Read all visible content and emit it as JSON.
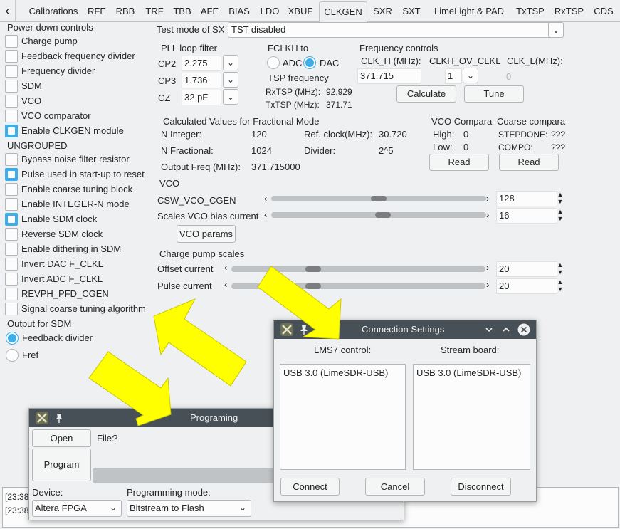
{
  "tabs": [
    "Calibrations",
    "RFE",
    "RBB",
    "TRF",
    "TBB",
    "AFE",
    "BIAS",
    "LDO",
    "XBUF",
    "CLKGEN",
    "SXR",
    "SXT",
    "LimeLight & PAD",
    "TxTSP",
    "RxTSP",
    "CDS"
  ],
  "active_tab": "CLKGEN",
  "left_panel": {
    "power_down_title": "Power down controls",
    "power_down": [
      {
        "label": "Charge pump",
        "checked": false
      },
      {
        "label": "Feedback frequency divider",
        "checked": false
      },
      {
        "label": "Frequency divider",
        "checked": false
      },
      {
        "label": "SDM",
        "checked": false
      },
      {
        "label": "VCO",
        "checked": false
      },
      {
        "label": "VCO comparator",
        "checked": false
      },
      {
        "label": "Enable CLKGEN module",
        "checked": true
      }
    ],
    "ungrouped_title": "UNGROUPED",
    "ungrouped": [
      {
        "label": "Bypass noise filter resistor",
        "checked": false
      },
      {
        "label": "Pulse used in start-up to reset",
        "checked": true
      },
      {
        "label": "Enable coarse tuning block",
        "checked": false
      },
      {
        "label": "Enable INTEGER-N mode",
        "checked": false
      },
      {
        "label": "Enable SDM clock",
        "checked": true
      },
      {
        "label": "Reverse SDM clock",
        "checked": false
      },
      {
        "label": "Enable dithering in SDM",
        "checked": false
      },
      {
        "label": "Invert DAC F_CLKL",
        "checked": false
      },
      {
        "label": "Invert ADC F_CLKL",
        "checked": false
      },
      {
        "label": "REVPH_PFD_CGEN",
        "checked": false
      },
      {
        "label": "Signal coarse tuning algorithm",
        "checked": false
      }
    ],
    "output_title": "Output for SDM",
    "output_options": [
      {
        "label": "Feedback divider",
        "selected": true
      },
      {
        "label": "Fref",
        "selected": false
      }
    ]
  },
  "test_mode": {
    "label": "Test mode of SX",
    "value": "TST disabled"
  },
  "pll": {
    "title": "PLL loop filter",
    "rows": [
      {
        "label": "CP2",
        "value": "2.275 pF"
      },
      {
        "label": "CP3",
        "value": "1.736 pF"
      },
      {
        "label": "CZ",
        "value": "32 pF"
      }
    ]
  },
  "fclkh": {
    "title": "FCLKH to",
    "options": [
      {
        "label": "ADC",
        "selected": false
      },
      {
        "label": "DAC",
        "selected": true
      }
    ]
  },
  "tsp": {
    "title": "TSP frequency",
    "rx_label": "RxTSP (MHz):",
    "rx_value": "92.929",
    "tx_label": "TxTSP (MHz):",
    "tx_value": "371.71"
  },
  "freq": {
    "title": "Frequency controls",
    "clkh_label": "CLK_H (MHz):",
    "clkh_value": "371.715",
    "ov_label": "CLKH_OV_CLKL",
    "ov_value": "1",
    "clkl_label": "CLK_L(MHz):",
    "clkl_value": "0",
    "calculate": "Calculate",
    "tune": "Tune"
  },
  "calc": {
    "title": "Calculated Values for Fractional Mode",
    "n_int_label": "N Integer:",
    "n_int": "120",
    "ref_label": "Ref. clock(MHz):",
    "ref": "30.720",
    "n_frac_label": "N Fractional:",
    "n_frac": "1024",
    "div_label": "Divider:",
    "div": "2^5",
    "out_label": "Output Freq (MHz):",
    "out": "371.715000"
  },
  "vco_comp": {
    "title": "VCO Compara",
    "high_label": "High:",
    "high": "0",
    "low_label": "Low:",
    "low": "0",
    "read": "Read"
  },
  "coarse": {
    "title": "Coarse compara",
    "stepdone_label": "STEPDONE:",
    "stepdone": "???",
    "compo_label": "COMPO:",
    "compo": "???",
    "read": "Read"
  },
  "vco": {
    "title": "VCO",
    "csw_label": "CSW_VCO_CGEN",
    "csw_value": "128",
    "csw_level": 0.5,
    "bias_label": "Scales VCO bias current",
    "bias_value": "16",
    "bias_level": 0.52,
    "params": "VCO params"
  },
  "cp": {
    "title": "Charge pump scales",
    "offset_label": "Offset current",
    "offset_value": "20",
    "offset_level": 0.31,
    "pulse_label": "Pulse current",
    "pulse_value": "20",
    "pulse_level": 0.31
  },
  "log_lines": [
    "[23:38",
    "[23:38"
  ],
  "programming": {
    "title": "Programing",
    "open": "Open",
    "program": "Program",
    "file_label": "File:",
    "file_value": "?",
    "device_label": "Device:",
    "device_value": "Altera FPGA",
    "mode_label": "Programming mode:",
    "mode_value": "Bitstream to Flash"
  },
  "connection": {
    "title": "Connection Settings",
    "lms_label": "LMS7 control:",
    "stream_label": "Stream board:",
    "lms_item": "USB 3.0 (LimeSDR-USB)",
    "stream_item": "USB 3.0 (LimeSDR-USB)",
    "connect": "Connect",
    "cancel": "Cancel",
    "disconnect": "Disconnect"
  },
  "colors": {
    "accent": "#3daee9",
    "titlebar": "#475057",
    "annotation_arrow": "#ffff00"
  }
}
